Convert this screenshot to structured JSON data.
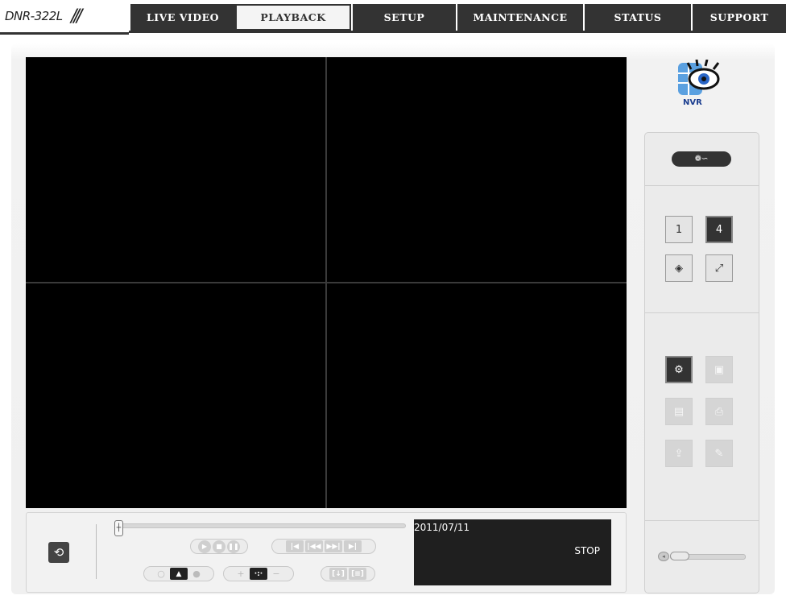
{
  "brand": {
    "model": "DNR-322L",
    "slashes": "///"
  },
  "nav": {
    "tabs": [
      {
        "label": "LIVE VIDEO"
      },
      {
        "label": "PLAYBACK"
      },
      {
        "label": "SETUP"
      },
      {
        "label": "MAINTENANCE"
      },
      {
        "label": "STATUS"
      },
      {
        "label": "SUPPORT"
      }
    ],
    "active": "PLAYBACK"
  },
  "nvr_logo": {
    "label": "NVR"
  },
  "playback": {
    "date": "2011/07/11",
    "status": "STOP",
    "layout_buttons": [
      "1",
      "4"
    ]
  },
  "icons": {
    "refresh": "refresh-icon",
    "mode": "film-play-icon",
    "settings": "gear-icon",
    "save": "save-icon",
    "snapshot": "snapshot-icon",
    "print": "print-icon",
    "backup": "backup-icon",
    "edit": "pencil-icon",
    "volume": "speaker-icon"
  },
  "colors": {
    "nav_bg": "#333333",
    "active_tab_bg": "#f4f4f4",
    "video_bg": "#000000",
    "panel_bg": "#ebebeb"
  }
}
